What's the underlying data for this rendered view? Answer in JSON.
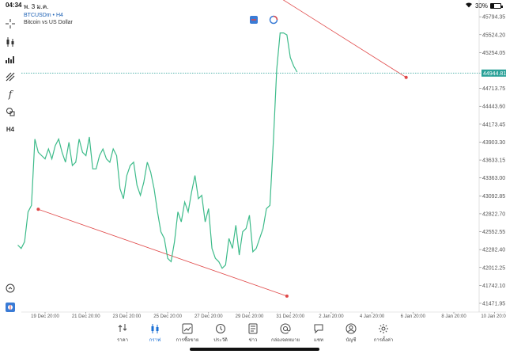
{
  "status": {
    "time": "04:34",
    "date": "พ. 3 ม.ค.",
    "battery": "30%",
    "battery_level": 0.3
  },
  "header": {
    "symbol": "BTCUSDm • H4",
    "description": "Bitcoin vs US Dollar"
  },
  "toolbar_icons": [
    "crosshair-icon",
    "candlestick-icon",
    "indicators-icon",
    "objects-icon",
    "function-icon",
    "shapes-icon",
    "timeframe-icon",
    "clock-icon",
    "trade-icon"
  ],
  "toolbar_timeframe": "H4",
  "chart_data": {
    "type": "line",
    "symbol": "BTCUSDm",
    "timeframe": "H4",
    "color": "#3dbb8a",
    "current_price": "44944.81",
    "price_line_color": "#2aa198",
    "y_ticks": [
      "45794.35",
      "45524.20",
      "45254.05",
      "44983.90",
      "44713.75",
      "44443.60",
      "44173.45",
      "43903.30",
      "43633.15",
      "43363.00",
      "43092.85",
      "42822.70",
      "42552.55",
      "42282.40",
      "42012.25",
      "41742.10",
      "41471.95"
    ],
    "x_ticks": [
      "19 Dec 20:00",
      "21 Dec 20:00",
      "23 Dec 20:00",
      "25 Dec 20:00",
      "27 Dec 20:00",
      "29 Dec 20:00",
      "31 Dec 20:00",
      "2 Jan 20:00",
      "4 Jan 20:00",
      "6 Jan 20:00",
      "8 Jan 20:00",
      "10 Jan 20:00"
    ],
    "x_start": "18 Dec 12:00",
    "x_step_hours": 4,
    "y_range": [
      41400,
      45880
    ],
    "values": [
      42350,
      42300,
      42400,
      42850,
      42950,
      43950,
      43750,
      43700,
      43650,
      43800,
      43650,
      43850,
      43950,
      43750,
      43600,
      43900,
      43550,
      43600,
      43950,
      43750,
      43700,
      43980,
      43500,
      43500,
      43700,
      43800,
      43650,
      43600,
      43800,
      43700,
      43200,
      43050,
      43400,
      43550,
      43600,
      43250,
      43100,
      43300,
      43600,
      43450,
      43200,
      42850,
      42550,
      42450,
      42150,
      42100,
      42400,
      42850,
      42700,
      43000,
      42850,
      43150,
      43400,
      43050,
      43100,
      42700,
      42900,
      42300,
      42150,
      42100,
      42000,
      42050,
      42450,
      42300,
      42650,
      42200,
      42550,
      42600,
      42800,
      42250,
      42300,
      42450,
      42600,
      42900,
      42950,
      43900,
      45000,
      45550,
      45550,
      45520,
      45180,
      45050,
      44960
    ],
    "trendlines": [
      {
        "color": "#e04848",
        "from": [
          "19 Dec 12:00",
          42890
        ],
        "to": [
          "31 Dec 16:00",
          41580
        ]
      },
      {
        "color": "#e04848",
        "from": [
          "29 Dec 04:00",
          46500
        ],
        "to": [
          "6 Jan 12:00",
          44880
        ]
      }
    ],
    "grid": false
  },
  "nav": {
    "items": [
      {
        "label": "ราคา",
        "icon": "quotes-icon"
      },
      {
        "label": "กราฟ",
        "icon": "chart-icon"
      },
      {
        "label": "การซื้อขาย",
        "icon": "trade-icon"
      },
      {
        "label": "ประวัติ",
        "icon": "history-icon"
      },
      {
        "label": "ข่าว",
        "icon": "news-icon"
      },
      {
        "label": "กล่องจดหมาย",
        "icon": "mailbox-icon"
      },
      {
        "label": "แชท",
        "icon": "chat-icon"
      },
      {
        "label": "บัญชี",
        "icon": "account-icon"
      },
      {
        "label": "การตั้งค่า",
        "icon": "settings-icon"
      }
    ]
  }
}
